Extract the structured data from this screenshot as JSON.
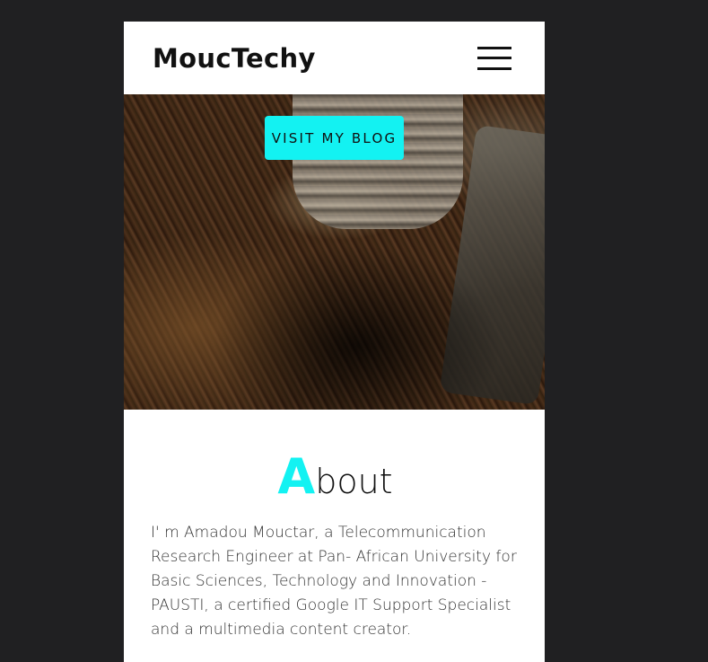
{
  "header": {
    "brand": "MoucTechy",
    "menu_icon": "hamburger-menu-icon"
  },
  "hero": {
    "cta_label": "VISIT MY BLOG",
    "accent_color": "#13f2f2"
  },
  "about": {
    "title_initial": "A",
    "title_rest": "bout",
    "text": "I' m Amadou Mouctar, a Telecommunication Research Engineer at Pan- African University for Basic Sciences, Technology and Innovation - PAUSTI, a certified Google IT Support Specialist and a multimedia content creator."
  }
}
